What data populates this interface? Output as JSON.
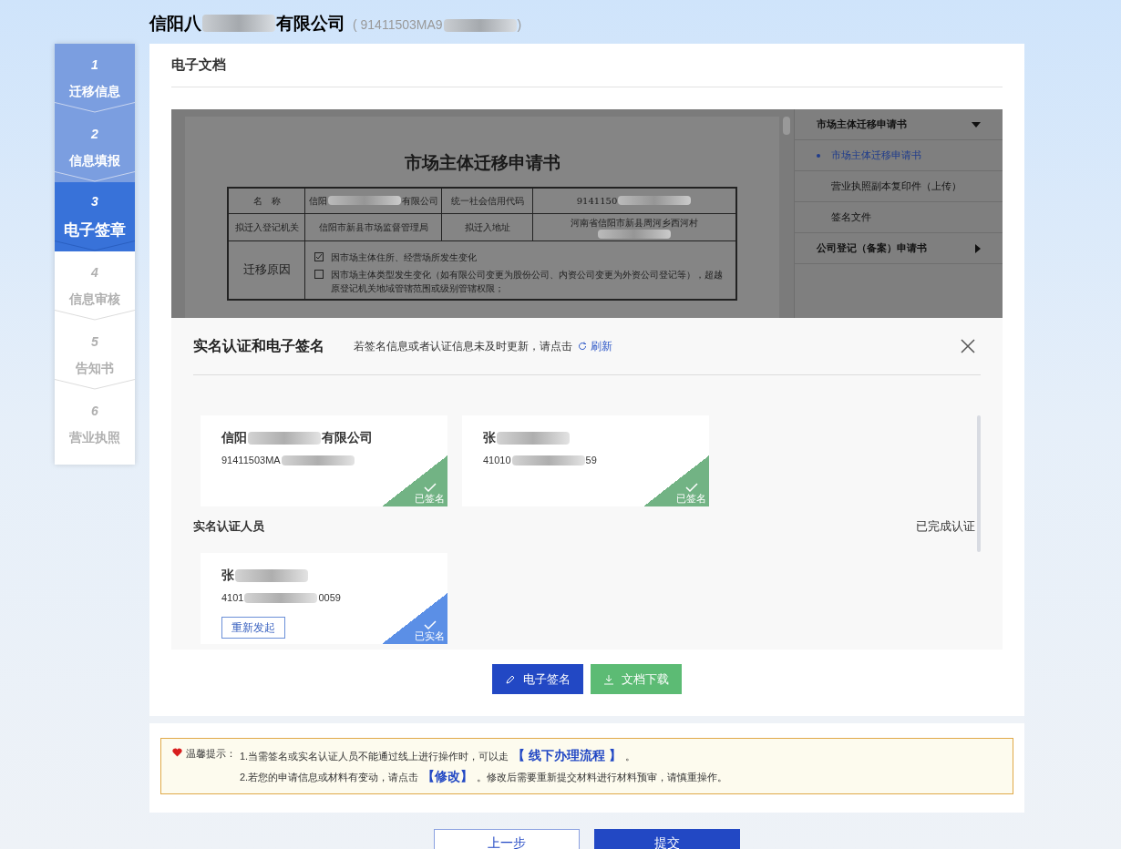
{
  "header": {
    "company": [
      {
        "kind": "text",
        "text": "信阳八"
      },
      {
        "kind": "redacted"
      },
      {
        "kind": "text",
        "text": "有限公司"
      }
    ],
    "code": [
      {
        "kind": "text",
        "text": "( 91411503MA9"
      },
      {
        "kind": "redacted"
      },
      {
        "kind": "text",
        "text": ")"
      }
    ]
  },
  "steps": [
    {
      "number": "1",
      "label": "迁移信息",
      "completed": true,
      "selected": false
    },
    {
      "number": "2",
      "label": "信息填报",
      "completed": true,
      "selected": false
    },
    {
      "number": "3",
      "label": "电子签章",
      "completed": false,
      "selected": true
    },
    {
      "number": "4",
      "label": "信息审核",
      "completed": false,
      "selected": false
    },
    {
      "number": "5",
      "label": "告知书",
      "completed": false,
      "selected": false
    },
    {
      "number": "6",
      "label": "营业执照",
      "completed": false,
      "selected": false
    }
  ],
  "panel": {
    "title": "电子文档"
  },
  "document": {
    "title": "市场主体迁移申请书",
    "rows": [
      [
        [
          {
            "kind": "text",
            "text": "名　称"
          }
        ],
        [
          {
            "kind": "text",
            "text": "信阳"
          },
          {
            "kind": "redacted"
          },
          {
            "kind": "text",
            "text": "有限公司"
          }
        ],
        [
          {
            "kind": "text",
            "text": "统一社会信用代码"
          }
        ],
        [
          {
            "kind": "text",
            "text": "9141150"
          },
          {
            "kind": "redacted"
          }
        ]
      ],
      [
        [
          {
            "kind": "text",
            "text": "拟迁入登记机关"
          }
        ],
        [
          {
            "kind": "text",
            "text": "信阳市新县市场监督管理局"
          }
        ],
        [
          {
            "kind": "text",
            "text": "拟迁入地址"
          }
        ],
        [
          {
            "kind": "text",
            "text": "河南省信阳市新县周河乡西河村"
          },
          {
            "kind": "redacted"
          }
        ]
      ]
    ],
    "reason_label": "迁移原因",
    "reasons": [
      {
        "checked": true,
        "text": "因市场主体住所、经营场所发生变化"
      },
      {
        "checked": false,
        "text": "因市场主体类型发生变化（如有限公司变更为股份公司、内资公司变更为外资公司登记等），超越原登记机关地域管辖范围或级别管辖权限；"
      }
    ]
  },
  "doc_nav": [
    {
      "title": "市场主体迁移申请书",
      "expanded": true,
      "items": [
        {
          "label": "市场主体迁移申请书",
          "selected": true
        },
        {
          "label": "营业执照副本复印件（上传）",
          "selected": false
        },
        {
          "label": "签名文件",
          "selected": false
        }
      ]
    },
    {
      "title": "公司登记（备案）申请书",
      "expanded": false
    }
  ],
  "dialog": {
    "title": "实名认证和电子签名",
    "hint": "若签名信息或者认证信息未及时更新，请点击",
    "refresh": "刷新",
    "signers": [
      {
        "kind": "signature",
        "name": [
          {
            "kind": "text",
            "text": "信阳"
          },
          {
            "kind": "redacted"
          },
          {
            "kind": "text",
            "text": "有限公司"
          }
        ],
        "id": [
          {
            "kind": "text",
            "text": "91411503MA"
          },
          {
            "kind": "redacted"
          }
        ],
        "badge": "已签名"
      },
      {
        "kind": "signature",
        "name": [
          {
            "kind": "text",
            "text": "张"
          },
          {
            "kind": "redacted"
          }
        ],
        "id": [
          {
            "kind": "text",
            "text": "41010"
          },
          {
            "kind": "redacted"
          },
          {
            "kind": "text",
            "text": "59"
          }
        ],
        "badge": "已签名"
      }
    ],
    "section_title": "实名认证人员",
    "section_status": "已完成认证",
    "verified": [
      {
        "kind": "verification",
        "name": [
          {
            "kind": "text",
            "text": "张"
          },
          {
            "kind": "redacted"
          }
        ],
        "id": [
          {
            "kind": "text",
            "text": "4101"
          },
          {
            "kind": "redacted"
          },
          {
            "kind": "text",
            "text": "0059"
          }
        ],
        "button": "重新发起",
        "badge": "已实名"
      }
    ]
  },
  "actions": [
    {
      "kind": "sign",
      "label": "电子签名"
    },
    {
      "kind": "download",
      "label": "文档下载"
    }
  ],
  "notice": {
    "label": "温馨提示：",
    "lines": [
      [
        {
          "kind": "text",
          "text": "1.当需签名或实名认证人员不能通过线上进行操作时，可以走"
        },
        {
          "kind": "link",
          "text": "【 线下办理流程 】"
        },
        {
          "kind": "text",
          "text": "。"
        }
      ],
      [
        {
          "kind": "text",
          "text": "2.若您的申请信息或材料有变动，请点击"
        },
        {
          "kind": "link",
          "text": "【修改】"
        },
        {
          "kind": "text",
          "text": "。修改后需要重新提交材料进行材料预审，请慎重操作。"
        }
      ]
    ]
  },
  "footer_buttons": [
    {
      "kind": "secondary",
      "label": "上一步"
    },
    {
      "kind": "primary",
      "label": "提交"
    }
  ]
}
